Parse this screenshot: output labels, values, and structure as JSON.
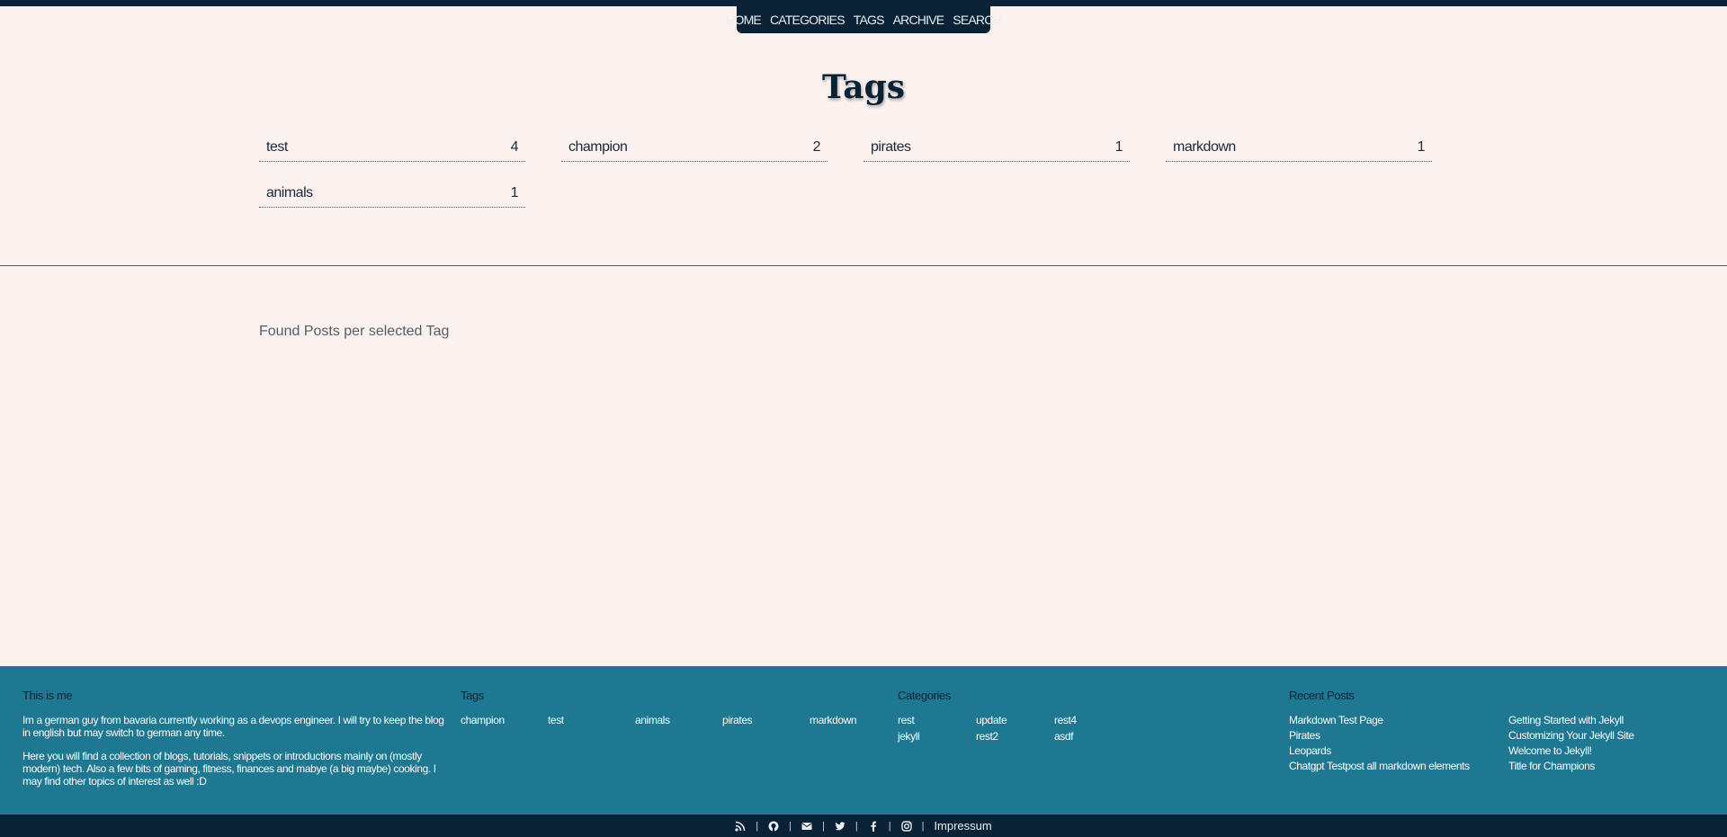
{
  "nav": {
    "items": [
      {
        "label": "HOME"
      },
      {
        "label": "CATEGORIES"
      },
      {
        "label": "TAGS"
      },
      {
        "label": "ARCHIVE"
      },
      {
        "label": "SEARCH"
      }
    ]
  },
  "page": {
    "title": "Tags",
    "found_label": "Found Posts per selected Tag"
  },
  "tags": [
    {
      "name": "test",
      "count": "4"
    },
    {
      "name": "champion",
      "count": "2"
    },
    {
      "name": "pirates",
      "count": "1"
    },
    {
      "name": "markdown",
      "count": "1"
    },
    {
      "name": "animals",
      "count": "1"
    }
  ],
  "footer": {
    "about": {
      "heading": "This is me",
      "p1": "Im a german guy from bavaria currently working as a devops engineer. I will try to keep the blog in english but may switch to german any time.",
      "p2": "Here you will find a collection of blogs, tutorials, snippets or introductions mainly on (mostly modern) tech. Also a few bits of gaming, fitness, finances and mabye (a big maybe) cooking. I may find other topics of interest as well :D"
    },
    "tags": {
      "heading": "Tags",
      "items": [
        "champion",
        "test",
        "animals",
        "pirates",
        "markdown"
      ]
    },
    "categories": {
      "heading": "Categories",
      "items": [
        "rest",
        "update",
        "rest4",
        "jekyll",
        "rest2",
        "asdf"
      ]
    },
    "recent": {
      "heading": "Recent Posts",
      "items": [
        "Markdown Test Page",
        "Pirates",
        "Leopards",
        "Chatgpt Testpost all markdown elements",
        "Getting Started with Jekyll",
        "Customizing Your Jekyll Site",
        "Welcome to Jekyll!",
        "Title for Champions"
      ]
    }
  },
  "bottom": {
    "icons": [
      "rss-icon",
      "github-icon",
      "email-icon",
      "twitter-icon",
      "facebook-icon",
      "instagram-icon"
    ],
    "separator": "|",
    "impressum": "Impressum"
  },
  "colors": {
    "background": "#fbf2f0",
    "navy": "#0b2236",
    "footer_teal": "#1f7892"
  }
}
